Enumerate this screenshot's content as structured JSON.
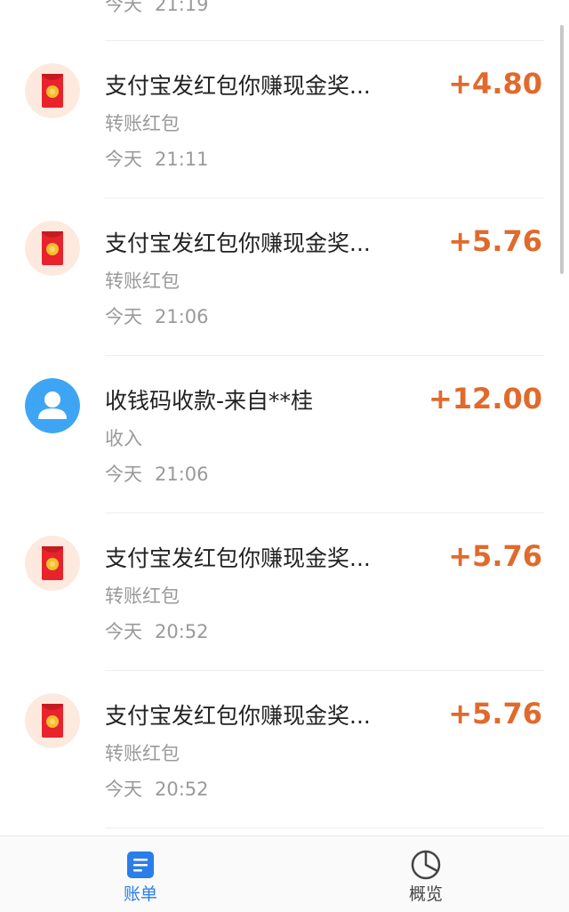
{
  "partial_row": {
    "day": "今天",
    "time": "21:19"
  },
  "transactions": [
    {
      "title": "支付宝发红包你赚现金奖...",
      "subtitle": "转账红包",
      "day": "今天",
      "time": "21:11",
      "amount": "+4.80",
      "icon": "red-envelope-icon"
    },
    {
      "title": "支付宝发红包你赚现金奖...",
      "subtitle": "转账红包",
      "day": "今天",
      "time": "21:06",
      "amount": "+5.76",
      "icon": "red-envelope-icon"
    },
    {
      "title": "收钱码收款-来自**桂",
      "subtitle": "收入",
      "day": "今天",
      "time": "21:06",
      "amount": "+12.00",
      "icon": "user-avatar-icon"
    },
    {
      "title": "支付宝发红包你赚现金奖...",
      "subtitle": "转账红包",
      "day": "今天",
      "time": "20:52",
      "amount": "+5.76",
      "icon": "red-envelope-icon"
    },
    {
      "title": "支付宝发红包你赚现金奖...",
      "subtitle": "转账红包",
      "day": "今天",
      "time": "20:52",
      "amount": "+5.76",
      "icon": "red-envelope-icon"
    }
  ],
  "tabbar": {
    "bill_label": "账单",
    "overview_label": "概览"
  },
  "colors": {
    "amount": "#e06a2c",
    "active_tab": "#2b7de9",
    "red_envelope": "#e8232c",
    "avatar_blue": "#3ea5f5"
  }
}
